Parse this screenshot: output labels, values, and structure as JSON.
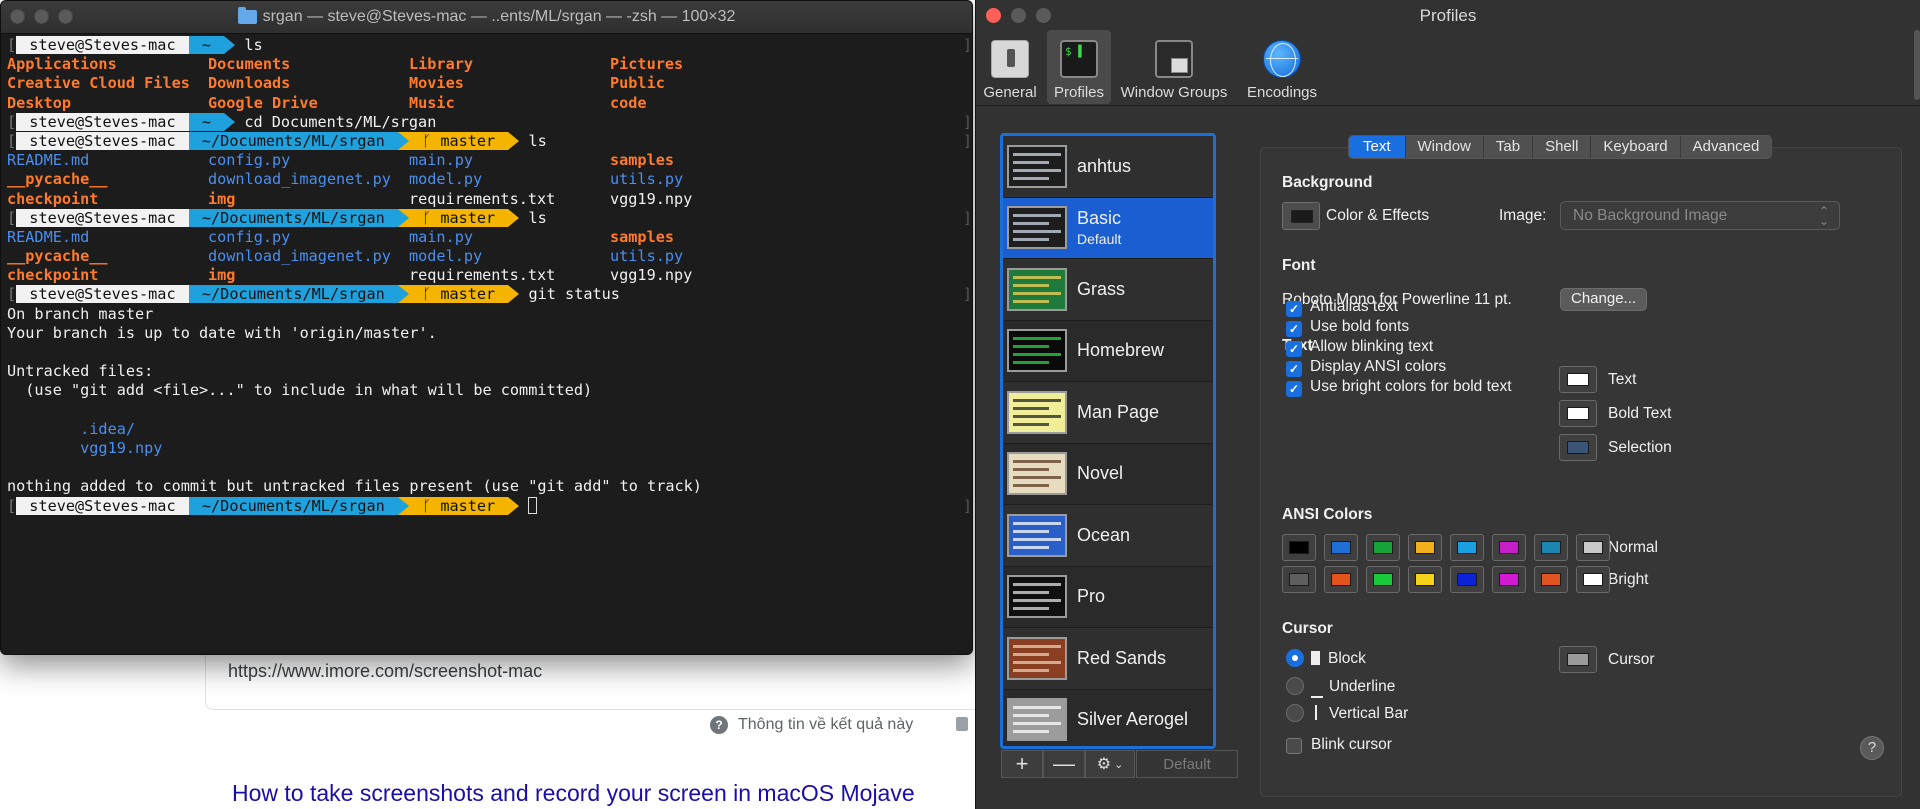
{
  "background_page": {
    "url": "https://www.imore.com/screenshot-mac",
    "info_text": "Thông tin về kết quả này",
    "link_title": "How to take screenshots and record your screen in macOS Mojave"
  },
  "terminal": {
    "title": "srgan — steve@Steves-mac — ..ents/ML/srgan — -zsh — 100×32",
    "prompt_user": "steve@Steves-mac",
    "home_dir": "~",
    "project_dir": "~/Documents/ML/srgan",
    "branch": "master",
    "branch_glyph": "ᚴ",
    "cmd_ls": "ls",
    "cmd_cd": "cd Documents/ML/srgan",
    "cmd_git_status": "git status",
    "home_listing": [
      [
        "Applications",
        "Documents",
        "Library",
        "Pictures"
      ],
      [
        "Creative Cloud Files",
        "Downloads",
        "Movies",
        "Public"
      ],
      [
        "Desktop",
        "Google Drive",
        "Music",
        "code"
      ]
    ],
    "srgan_listing": [
      [
        {
          "t": "README.md",
          "c": "blue"
        },
        {
          "t": "config.py",
          "c": "blue"
        },
        {
          "t": "main.py",
          "c": "blue"
        },
        {
          "t": "samples",
          "c": "orange"
        }
      ],
      [
        {
          "t": "__pycache__",
          "c": "orange"
        },
        {
          "t": "download_imagenet.py",
          "c": "blue"
        },
        {
          "t": "model.py",
          "c": "blue"
        },
        {
          "t": "utils.py",
          "c": "blue"
        }
      ],
      [
        {
          "t": "checkpoint",
          "c": "orange"
        },
        {
          "t": "img",
          "c": "orange"
        },
        {
          "t": "requirements.txt",
          "c": "white"
        },
        {
          "t": "vgg19.npy",
          "c": "white"
        }
      ]
    ],
    "git_output": {
      "on_branch": "On branch master",
      "up_to_date": "Your branch is up to date with 'origin/master'.",
      "untracked_header": "Untracked files:",
      "untracked_hint": "  (use \"git add <file>...\" to include in what will be committed)",
      "untracked_1": "        .idea/",
      "untracked_2": "        vgg19.npy",
      "summary": "nothing added to commit but untracked files present (use \"git add\" to track)"
    }
  },
  "profiles": {
    "title": "Profiles",
    "toolbar": [
      "General",
      "Profiles",
      "Window Groups",
      "Encodings"
    ],
    "list": [
      {
        "name": "anhtus",
        "sub": "",
        "bg": "#1e1e1e",
        "fg": "#cfd8e8"
      },
      {
        "name": "Basic",
        "sub": "Default",
        "bg": "#1e1e1e",
        "fg": "#cfd8e8"
      },
      {
        "name": "Grass",
        "sub": "",
        "bg": "#1f7a3c",
        "fg": "#f4d35e"
      },
      {
        "name": "Homebrew",
        "sub": "",
        "bg": "#0a0a0a",
        "fg": "#2fd24a"
      },
      {
        "name": "Man Page",
        "sub": "",
        "bg": "#f1ee9a",
        "fg": "#222222"
      },
      {
        "name": "Novel",
        "sub": "",
        "bg": "#e8dcc0",
        "fg": "#5a3b22"
      },
      {
        "name": "Ocean",
        "sub": "",
        "bg": "#2a5fc8",
        "fg": "#ffffff"
      },
      {
        "name": "Pro",
        "sub": "",
        "bg": "#101010",
        "fg": "#e0e0e0"
      },
      {
        "name": "Red Sands",
        "sub": "",
        "bg": "#8a3e22",
        "fg": "#e9d2b0"
      },
      {
        "name": "Silver Aerogel",
        "sub": "",
        "bg": "#9c9c9c",
        "fg": "#ffffff"
      }
    ],
    "list_buttons": {
      "add": "+",
      "remove": "—",
      "gear": "⚙",
      "default": "Default"
    },
    "tabs": [
      "Text",
      "Window",
      "Tab",
      "Shell",
      "Keyboard",
      "Advanced"
    ],
    "background": {
      "header": "Background",
      "color_effects": "Color & Effects",
      "image_label": "Image:",
      "image_value": "No Background Image"
    },
    "font": {
      "header": "Font",
      "value": "Roboto Mono for Powerline 11 pt.",
      "change_button": "Change..."
    },
    "text": {
      "header": "Text",
      "options": [
        "Antialias text",
        "Use bold fonts",
        "Allow blinking text",
        "Display ANSI colors",
        "Use bright colors for bold text"
      ],
      "wells": [
        "Text",
        "Bold Text",
        "Selection"
      ]
    },
    "ansi": {
      "header": "ANSI Colors",
      "normal_label": "Normal",
      "bright_label": "Bright",
      "normal": [
        "#000000",
        "#1f6fd6",
        "#18a23a",
        "#f2b01e",
        "#1aa0e0",
        "#c71fc7",
        "#1b87b0",
        "#c8c8c8"
      ],
      "bright": [
        "#5e5e5e",
        "#e2541c",
        "#19c93c",
        "#f5d31a",
        "#0a22d8",
        "#d21ad2",
        "#e05420",
        "#ffffff"
      ]
    },
    "cursor": {
      "header": "Cursor",
      "block": "Block",
      "underline": "Underline",
      "vertical_bar": "Vertical Bar",
      "blink": "Blink cursor",
      "well_label": "Cursor"
    },
    "help": "?"
  }
}
